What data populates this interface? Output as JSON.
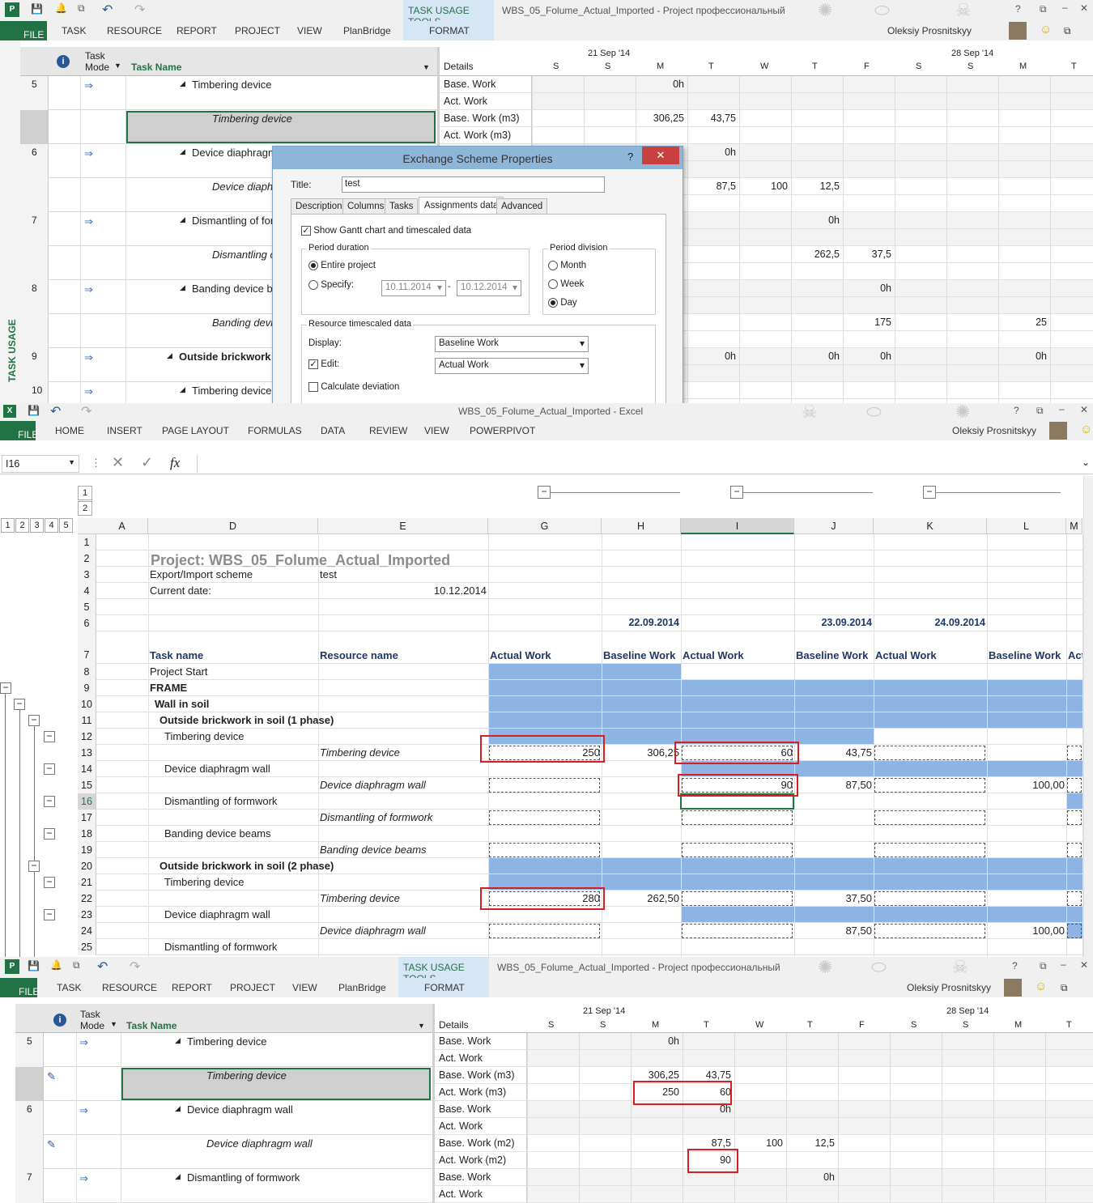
{
  "project_window": {
    "title": "WBS_05_Folume_Actual_Imported - Project профессиональный",
    "user": "Oleksiy Prosnitskyy",
    "tools_tab": "TASK USAGE TOOLS",
    "format_tab": "FORMAT",
    "tabs": [
      "FILE",
      "TASK",
      "RESOURCE",
      "REPORT",
      "PROJECT",
      "VIEW",
      "PlanBridge"
    ],
    "view_label": "TASK USAGE",
    "columns": {
      "task_mode": "Task Mode",
      "task_name": "Task Name",
      "details": "Details"
    },
    "weeks": [
      "21 Sep '14",
      "28 Sep '14"
    ],
    "days": [
      "S",
      "S",
      "M",
      "T",
      "W",
      "T",
      "F",
      "S",
      "S",
      "M",
      "T"
    ],
    "rows": [
      {
        "id": "5",
        "name": "Timbering device",
        "italic": false,
        "bold": false
      },
      {
        "id": "",
        "name": "Timbering device",
        "italic": true,
        "bold": false
      },
      {
        "id": "6",
        "name": "Device diaphragm wall",
        "italic": false,
        "bold": false
      },
      {
        "id": "",
        "name": "Device diaphragm wall",
        "italic": true,
        "bold": false
      },
      {
        "id": "7",
        "name": "Dismantling of formwork",
        "italic": false,
        "bold": false
      },
      {
        "id": "",
        "name": "Dismantling of formwork",
        "italic": true,
        "bold": false
      },
      {
        "id": "8",
        "name": "Banding device beams",
        "italic": false,
        "bold": false
      },
      {
        "id": "",
        "name": "Banding device beams",
        "italic": true,
        "bold": false
      },
      {
        "id": "9",
        "name": "Outside brickwork in soil (1 phase)",
        "italic": false,
        "bold": true
      },
      {
        "id": "10",
        "name": "Timbering device",
        "italic": false,
        "bold": false
      }
    ],
    "details_rows": [
      "Base. Work",
      "Act. Work",
      "Base. Work (m3)",
      "Act. Work (m3)"
    ],
    "timescale_values": [
      {
        "row": 0,
        "col": 3,
        "v": "0h"
      },
      {
        "row": 2,
        "col": 3,
        "v": "306,25"
      },
      {
        "row": 2,
        "col": 4,
        "v": "43,75"
      },
      {
        "row": 4,
        "col": 4,
        "v": "0h"
      },
      {
        "row": 6,
        "col": 4,
        "v": "87,5"
      },
      {
        "row": 6,
        "col": 5,
        "v": "100"
      },
      {
        "row": 6,
        "col": 6,
        "v": "12,5"
      },
      {
        "row": 8,
        "col": 6,
        "v": "0h"
      },
      {
        "row": 10,
        "col": 6,
        "v": "262,5"
      },
      {
        "row": 10,
        "col": 7,
        "v": "37,5"
      },
      {
        "row": 12,
        "col": 7,
        "v": "0h"
      },
      {
        "row": 14,
        "col": 7,
        "v": "175"
      },
      {
        "row": 14,
        "col": 10,
        "v": "25"
      },
      {
        "row": 16,
        "col": 4,
        "v": "0h"
      },
      {
        "row": 16,
        "col": 6,
        "v": "0h"
      },
      {
        "row": 16,
        "col": 7,
        "v": "0h"
      },
      {
        "row": 16,
        "col": 10,
        "v": "0h"
      }
    ]
  },
  "dialog": {
    "title": "Exchange Scheme Properties",
    "help": "?",
    "close": "✕",
    "title_label": "Title:",
    "title_value": "test",
    "tabs": [
      "Description",
      "Columns",
      "Tasks",
      "Assignments data",
      "Advanced"
    ],
    "show_gantt": "Show Gantt chart and timescaled data",
    "period_duration": "Period duration",
    "entire_project": "Entire project",
    "specify": "Specify:",
    "date_from": "10.11.2014",
    "date_to": "10.12.2014",
    "dash": "-",
    "period_division": "Period division",
    "month": "Month",
    "week": "Week",
    "day": "Day",
    "resource_data": "Resource timescaled data",
    "display_label": "Display:",
    "display_value": "Baseline Work",
    "edit_label": "Edit:",
    "edit_value": "Actual Work",
    "calc_dev": "Calculate deviation"
  },
  "excel": {
    "title": "WBS_05_Folume_Actual_Imported - Excel",
    "user": "Oleksiy Prosnitskyy",
    "tabs": [
      "FILE",
      "HOME",
      "INSERT",
      "PAGE LAYOUT",
      "FORMULAS",
      "DATA",
      "REVIEW",
      "VIEW",
      "POWERPIVOT"
    ],
    "name_box": "I16",
    "fx": "fx",
    "outline_levels": [
      "1",
      "2",
      "3",
      "4",
      "5"
    ],
    "group_levels": [
      "1",
      "2"
    ],
    "columns": [
      "A",
      "D",
      "E",
      "G",
      "H",
      "I",
      "J",
      "K",
      "L",
      "M"
    ],
    "project_title": "Project: WBS_05_Folume_Actual_Imported",
    "export_label": "Export/Import scheme",
    "export_value": "test",
    "date_label": "Current date:",
    "date_value": "10.12.2014",
    "dates": [
      "22.09.2014",
      "23.09.2014",
      "24.09.2014"
    ],
    "col_task": "Task name",
    "col_resource": "Resource name",
    "col_actual": "Actual Work",
    "col_baseline": "Baseline Work",
    "col_act_short": "Act",
    "row_numbers": [
      "1",
      "2",
      "3",
      "4",
      "5",
      "6",
      "7",
      "8",
      "9",
      "10",
      "11",
      "12",
      "13",
      "14",
      "15",
      "16",
      "17",
      "18",
      "19",
      "20",
      "21",
      "22",
      "23",
      "24",
      "25"
    ],
    "tasks": [
      {
        "row": 8,
        "task": "Project Start",
        "res": "",
        "style": "n"
      },
      {
        "row": 9,
        "task": "FRAME",
        "res": "",
        "style": "b"
      },
      {
        "row": 10,
        "task": "Wall in soil",
        "res": "",
        "style": "b1"
      },
      {
        "row": 11,
        "task": "Outside brickwork in soil (1 phase)",
        "res": "",
        "style": "b2"
      },
      {
        "row": 12,
        "task": "Timbering device",
        "res": "",
        "style": "n3"
      },
      {
        "row": 13,
        "task": "",
        "res": "Timbering device",
        "style": "i"
      },
      {
        "row": 14,
        "task": "Device diaphragm wall",
        "res": "",
        "style": "n3"
      },
      {
        "row": 15,
        "task": "",
        "res": "Device diaphragm wall",
        "style": "i"
      },
      {
        "row": 16,
        "task": "Dismantling of formwork",
        "res": "",
        "style": "n3"
      },
      {
        "row": 17,
        "task": "",
        "res": "Dismantling of formwork",
        "style": "i"
      },
      {
        "row": 18,
        "task": "Banding device beams",
        "res": "",
        "style": "n3"
      },
      {
        "row": 19,
        "task": "",
        "res": "Banding device beams",
        "style": "i"
      },
      {
        "row": 20,
        "task": "Outside brickwork in soil (2 phase)",
        "res": "",
        "style": "b2"
      },
      {
        "row": 21,
        "task": "Timbering device",
        "res": "",
        "style": "n3"
      },
      {
        "row": 22,
        "task": "",
        "res": "Timbering device",
        "style": "i"
      },
      {
        "row": 23,
        "task": "Device diaphragm wall",
        "res": "",
        "style": "n3"
      },
      {
        "row": 24,
        "task": "",
        "res": "Device diaphragm wall",
        "style": "i"
      },
      {
        "row": 25,
        "task": "Dismantling of formwork",
        "res": "",
        "style": "n3"
      }
    ],
    "values": [
      {
        "row": 13,
        "col": "G",
        "v": "250"
      },
      {
        "row": 13,
        "col": "H",
        "v": "306,25"
      },
      {
        "row": 13,
        "col": "I",
        "v": "60"
      },
      {
        "row": 13,
        "col": "J",
        "v": "43,75"
      },
      {
        "row": 15,
        "col": "I",
        "v": "90"
      },
      {
        "row": 15,
        "col": "J",
        "v": "87,50"
      },
      {
        "row": 15,
        "col": "L",
        "v": "100,00"
      },
      {
        "row": 22,
        "col": "G",
        "v": "280"
      },
      {
        "row": 22,
        "col": "H",
        "v": "262,50"
      },
      {
        "row": 22,
        "col": "J",
        "v": "37,50"
      },
      {
        "row": 24,
        "col": "J",
        "v": "87,50"
      },
      {
        "row": 24,
        "col": "L",
        "v": "100,00"
      }
    ]
  },
  "project_window_2": {
    "rows": [
      {
        "id": "5",
        "name": "Timbering device",
        "italic": false
      },
      {
        "id": "",
        "name": "Timbering device",
        "italic": true
      },
      {
        "id": "6",
        "name": "Device diaphragm wall",
        "italic": false
      },
      {
        "id": "",
        "name": "Device diaphragm wall",
        "italic": true
      },
      {
        "id": "7",
        "name": "Dismantling of formwork",
        "italic": false
      }
    ],
    "details_rows": [
      "Base. Work",
      "Act. Work",
      "Base. Work (m3)",
      "Act. Work (m3)",
      "Base. Work",
      "Act. Work",
      "Base. Work (m2)",
      "Act. Work (m2)",
      "Base. Work",
      "Act. Work"
    ],
    "timescale_values": [
      {
        "row": 0,
        "col": 2,
        "v": "0h"
      },
      {
        "row": 2,
        "col": 2,
        "v": "306,25"
      },
      {
        "row": 2,
        "col": 3,
        "v": "43,75"
      },
      {
        "row": 3,
        "col": 2,
        "v": "250"
      },
      {
        "row": 3,
        "col": 3,
        "v": "60"
      },
      {
        "row": 4,
        "col": 3,
        "v": "0h"
      },
      {
        "row": 6,
        "col": 3,
        "v": "87,5"
      },
      {
        "row": 6,
        "col": 4,
        "v": "100"
      },
      {
        "row": 6,
        "col": 5,
        "v": "12,5"
      },
      {
        "row": 7,
        "col": 3,
        "v": "90"
      },
      {
        "row": 8,
        "col": 5,
        "v": "0h"
      }
    ]
  },
  "colors": {
    "project_green": "#217346",
    "excel_green": "#217346",
    "accent_blue": "#2b5797",
    "gantt_blue": "#8db4e2",
    "highlight_red": "#d81e1e"
  }
}
